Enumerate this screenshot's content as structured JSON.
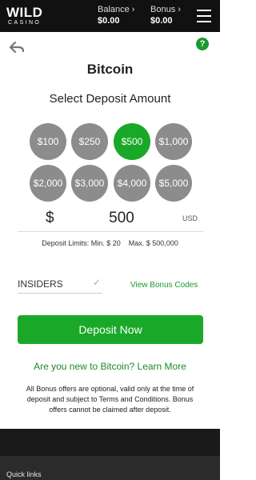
{
  "header": {
    "logo_word": "WILD",
    "logo_sub": "CASINO",
    "balance_label": "Balance",
    "balance_value": "$0.00",
    "bonus_label": "Bonus",
    "bonus_value": "$0.00"
  },
  "deposit": {
    "title": "Bitcoin",
    "subtitle": "Select Deposit Amount",
    "amounts": [
      "$100",
      "$250",
      "$500",
      "$1,000",
      "$2,000",
      "$3,000",
      "$4,000",
      "$5,000"
    ],
    "selected_amount": "$500",
    "currency_sign": "$",
    "amount_value": "500",
    "currency_code": "USD",
    "limits": "Deposit Limits: Min. $ 20    Max. $ 500,000",
    "promo_code": "INSIDERS",
    "view_bonus_codes": "View Bonus Codes",
    "deposit_button": "Deposit Now",
    "learn_more": "Are you new to Bitcoin? Learn More",
    "disclaimer": "All Bonus offers are optional, valid only at the time of deposit and subject to Terms and Conditions. Bonus offers cannot be claimed after deposit."
  },
  "footer": {
    "quick_links": "Quick links"
  },
  "colors": {
    "accent": "#1aa829",
    "amount_inactive": "#8c8c8c",
    "topbar": "#111111"
  },
  "icons": [
    "back-arrow-icon",
    "help-icon",
    "menu-icon",
    "check-icon",
    "chevron-right-icon"
  ]
}
